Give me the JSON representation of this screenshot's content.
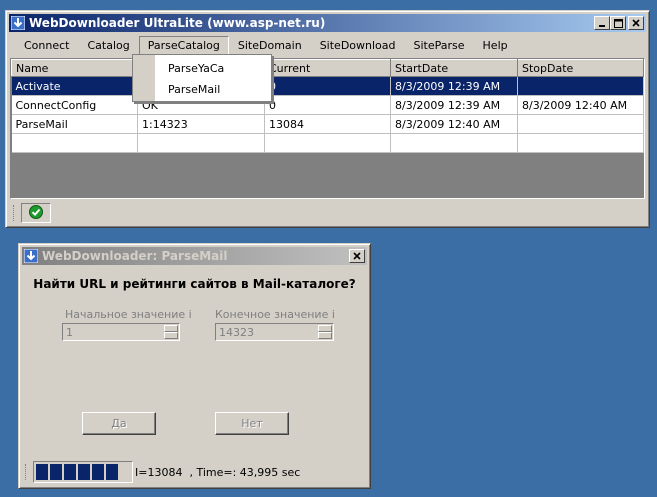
{
  "main_window": {
    "title": "WebDownloader UltraLite  (www.asp-net.ru)",
    "menu": [
      {
        "label": "Connect"
      },
      {
        "label": "Catalog"
      },
      {
        "label": "ParseCatalog"
      },
      {
        "label": "SiteDomain"
      },
      {
        "label": "SiteDownload"
      },
      {
        "label": "SiteParse"
      },
      {
        "label": "Help"
      }
    ],
    "parse_catalog_menu": [
      "ParseYaCa",
      "ParseMail"
    ],
    "grid": {
      "columns": [
        "Name",
        "",
        "Current",
        "StartDate",
        "StopDate"
      ],
      "rows": [
        [
          "Activate",
          "",
          "0",
          "8/3/2009 12:39 AM",
          ""
        ],
        [
          "ConnectConfig",
          "OK",
          "0",
          "8/3/2009 12:39 AM",
          "8/3/2009 12:40 AM"
        ],
        [
          "ParseMail",
          "1:14323",
          "13084",
          "8/3/2009 12:40 AM",
          ""
        ],
        [
          "",
          "",
          "",
          "",
          ""
        ]
      ]
    },
    "status_icon": "green-check-icon"
  },
  "dialog": {
    "title": "WebDownloader: ParseMail",
    "question": "Найти URL и рейтинги сайтов в Mail-каталоге?",
    "start_label": "Начальное значение i",
    "start_value": "1",
    "end_label": "Конечное значение i",
    "end_value": "14323",
    "yes_button": "Да",
    "no_button": "Нет",
    "status_text": "I=13084  , Time=: 43,995 sec"
  },
  "colors": {
    "desktop": "#3a6ea5",
    "active_title": "#0a246a",
    "selection": "#0a246a"
  }
}
